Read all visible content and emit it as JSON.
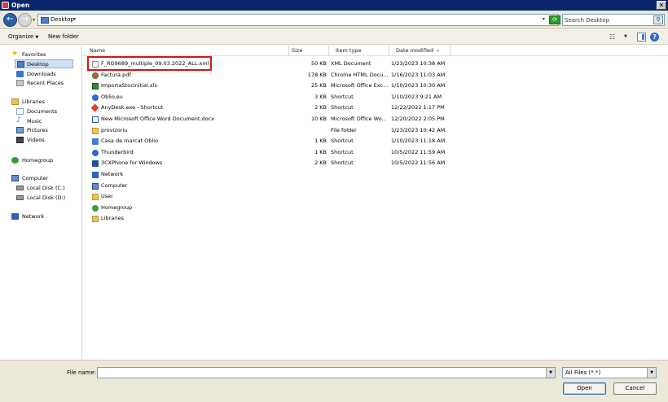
{
  "window": {
    "title": "Open"
  },
  "address": {
    "location": "Desktop",
    "search_placeholder": "Search Desktop"
  },
  "toolbar": {
    "organize_label": "Organize",
    "new_folder_label": "New folder"
  },
  "nav": {
    "favorites": "Favorites",
    "desktop": "Desktop",
    "downloads": "Downloads",
    "recent_places": "Recent Places",
    "libraries": "Libraries",
    "documents": "Documents",
    "music": "Music",
    "pictures": "Pictures",
    "videos": "Videos",
    "homegroup": "Homegroup",
    "computer": "Computer",
    "local_disk_c": "Local Disk (C:)",
    "local_disk_d": "Local Disk (D:)",
    "network": "Network"
  },
  "columns": {
    "name": "Name",
    "size": "Size",
    "type": "Item type",
    "date": "Date modified"
  },
  "files": [
    {
      "name": "F_RO9689_multiple_09.03.2022_ALL.xml",
      "size": "50 KB",
      "type": "XML Document",
      "date": "1/23/2023 10:38 AM",
      "icon": "xml-file-icon"
    },
    {
      "name": "Factura.pdf",
      "size": "178 KB",
      "type": "Chrome HTML Docu...",
      "date": "1/16/2023 11:03 AM",
      "icon": "chrome-pdf-icon"
    },
    {
      "name": "ImportaStocInitial.xls",
      "size": "25 KB",
      "type": "Microsoft Office Exc...",
      "date": "1/10/2023 10:30 AM",
      "icon": "excel-file-icon"
    },
    {
      "name": "Oblio.eu",
      "size": "3 KB",
      "type": "Shortcut",
      "date": "1/10/2023 9:21 AM",
      "icon": "web-shortcut-icon"
    },
    {
      "name": "AnyDesk.exe - Shortcut",
      "size": "2 KB",
      "type": "Shortcut",
      "date": "12/22/2022 1:17 PM",
      "icon": "anydesk-icon"
    },
    {
      "name": "New Microsoft Office Word Document.docx",
      "size": "10 KB",
      "type": "Microsoft Office Wo...",
      "date": "12/20/2022 2:05 PM",
      "icon": "word-file-icon"
    },
    {
      "name": "provizoriu",
      "size": "",
      "type": "File folder",
      "date": "1/23/2023 10:42 AM",
      "icon": "folder-icon"
    },
    {
      "name": "Casa de marcat Oblio",
      "size": "1 KB",
      "type": "Shortcut",
      "date": "1/10/2023 11:18 AM",
      "icon": "app-shortcut-icon"
    },
    {
      "name": "Thunderbird",
      "size": "1 KB",
      "type": "Shortcut",
      "date": "10/5/2022 11:59 AM",
      "icon": "thunderbird-icon"
    },
    {
      "name": "3CXPhone for Windows",
      "size": "2 KB",
      "type": "Shortcut",
      "date": "10/5/2022 11:56 AM",
      "icon": "phone-app-icon"
    },
    {
      "name": "Network",
      "size": "",
      "type": "",
      "date": "",
      "icon": "network-icon"
    },
    {
      "name": "Computer",
      "size": "",
      "type": "",
      "date": "",
      "icon": "computer-icon"
    },
    {
      "name": "User",
      "size": "",
      "type": "",
      "date": "",
      "icon": "user-folder-icon"
    },
    {
      "name": "Homegroup",
      "size": "",
      "type": "",
      "date": "",
      "icon": "homegroup-icon"
    },
    {
      "name": "Libraries",
      "size": "",
      "type": "",
      "date": "",
      "icon": "libraries-icon"
    }
  ],
  "bottom": {
    "file_name_label": "File name:",
    "file_name_value": "",
    "file_type": "All Files (*.*)",
    "open_label": "Open",
    "cancel_label": "Cancel"
  }
}
